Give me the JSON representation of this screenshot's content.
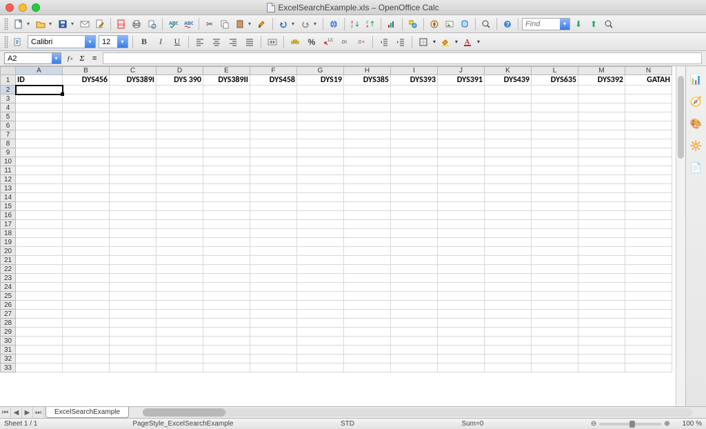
{
  "window": {
    "title": "ExcelSearchExample.xls – OpenOffice Calc"
  },
  "toolbar2": {
    "font_name": "Calibri",
    "font_size": "12"
  },
  "find": {
    "placeholder": "Find"
  },
  "formula_bar": {
    "cell_ref": "A2",
    "formula": ""
  },
  "columns": [
    "A",
    "B",
    "C",
    "D",
    "E",
    "F",
    "G",
    "H",
    "I",
    "J",
    "K",
    "L",
    "M",
    "N"
  ],
  "row_count": 33,
  "row1_data": [
    "ID",
    "DYS456",
    "DYS389I",
    "DYS 390",
    "DYS389II",
    "DYS458",
    "DYS19",
    "DYS385",
    "DYS393",
    "DYS391",
    "DYS439",
    "DYS635",
    "DYS392",
    "GATAH"
  ],
  "selected_cell": "A2",
  "sheet_tab": {
    "name": "ExcelSearchExample"
  },
  "statusbar": {
    "sheet": "Sheet 1 / 1",
    "style": "PageStyle_ExcelSearchExample",
    "mode": "STD",
    "sum": "Sum=0",
    "zoom": "100 %"
  },
  "icons": {
    "sidebar": [
      "📊",
      "🧭",
      "🎨",
      "🔆",
      "📄"
    ]
  }
}
